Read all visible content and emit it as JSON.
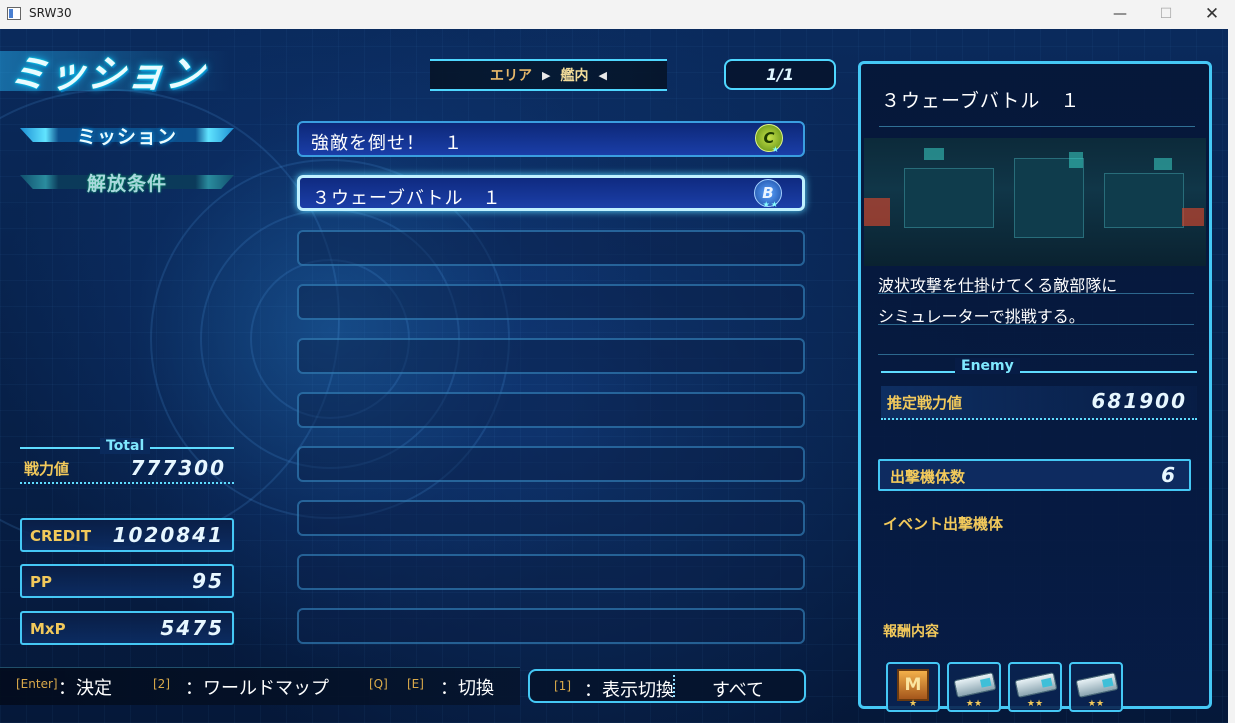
{
  "window": {
    "title": "SRW30",
    "min_glyph": "—",
    "max_glyph": "☐",
    "close_glyph": "✕"
  },
  "screen_title": "ミッション",
  "side_tabs": [
    {
      "label": "ミッション",
      "active": true
    },
    {
      "label": "解放条件",
      "active": false
    }
  ],
  "area": {
    "label": "エリア",
    "value": "艦内",
    "left_arrow": "▶",
    "right_arrow": "◀"
  },
  "page_indicator": "1/1",
  "missions": [
    {
      "name": "強敵を倒せ！　１",
      "rank": "C",
      "stars": "★",
      "selected": false
    },
    {
      "name": "３ウェーブバトル　１",
      "rank": "B",
      "stars": "★★",
      "selected": true
    }
  ],
  "totals": {
    "header": "Total",
    "power_label": "戦力値",
    "power_value": "777300",
    "credit_label": "CREDIT",
    "credit_value": "1020841",
    "pp_label": "PP",
    "pp_value": "95",
    "mxp_label": "MxP",
    "mxp_value": "5475"
  },
  "detail": {
    "title": "３ウェーブバトル　１",
    "description_1": "波状攻撃を仕掛けてくる敵部隊に",
    "description_2": "シミュレーターで挑戦する。",
    "enemy_header": "Enemy",
    "estimated_power_label": "推定戦力値",
    "estimated_power_value": "681900",
    "sortie_count_label": "出撃機体数",
    "sortie_count_value": "6",
    "event_units_label": "イベント出撃機体",
    "reward_label": "報酬内容",
    "rewards": [
      {
        "icon": "medal-m-icon",
        "glyph": "M",
        "stars": "★"
      },
      {
        "icon": "chip-item-icon",
        "stars": "★★"
      },
      {
        "icon": "chip-item-icon",
        "stars": "★★"
      },
      {
        "icon": "chip-item-icon",
        "stars": "★★"
      }
    ]
  },
  "controls": {
    "enter_key": "[Enter]",
    "enter_label": "：決定",
    "map_key": "[2]",
    "map_label": "：ワールドマップ",
    "switch_key_q": "[Q]",
    "switch_key_e": "[E]",
    "switch_label": "：切換",
    "display_key": "[1]",
    "display_label": "：表示切換",
    "display_value": "すべて"
  },
  "colors": {
    "accent": "#45c8f5",
    "label_gold": "#f2c95b",
    "background": "#072048"
  }
}
